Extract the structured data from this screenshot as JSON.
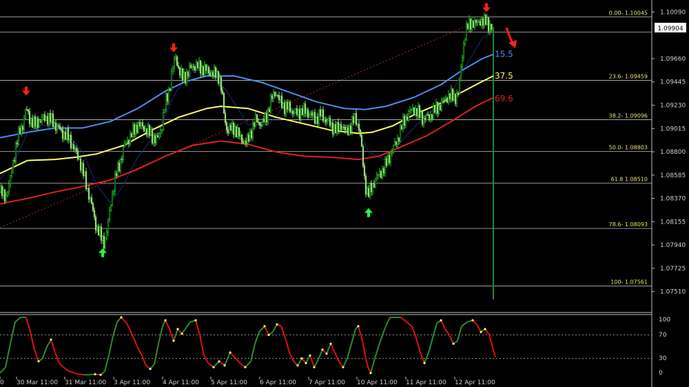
{
  "chart_data": {
    "type": "candlestick",
    "main": {
      "ylim": [
        1.074,
        1.1015
      ],
      "y_ticks": [
        "1.10090",
        "1.09660",
        "1.09445",
        "1.09230",
        "1.09015",
        "1.08800",
        "1.08585",
        "1.08370",
        "1.08155",
        "1.07940",
        "1.07725",
        "1.07510"
      ],
      "current_price": "1.09904",
      "fib_levels": [
        {
          "label": "0.00- 1.10045",
          "value": 1.10045
        },
        {
          "label": "23.6- 1.09459",
          "value": 1.09459
        },
        {
          "label": "38.2- 1.09096",
          "value": 1.09096
        },
        {
          "label": "50.0- 1.08803",
          "value": 1.08803
        },
        {
          "label": "61.8 1.08510",
          "value": 1.0851
        },
        {
          "label": "78.6- 1.08093",
          "value": 1.08093
        },
        {
          "label": "100- 1.07561",
          "value": 1.07561
        }
      ],
      "ma_labels": [
        {
          "text": "15.5",
          "color": "#4b8ff0",
          "value": 1.097
        },
        {
          "text": "37.5",
          "color": "#ffff66",
          "value": 1.095
        },
        {
          "text": "69.6",
          "color": "#e02020",
          "value": 1.0929
        }
      ],
      "close_path": [
        [
          0,
          1.0843
        ],
        [
          8,
          1.0838
        ],
        [
          15,
          1.0854
        ],
        [
          22,
          1.0882
        ],
        [
          28,
          1.0898
        ],
        [
          33,
          1.0905
        ],
        [
          38,
          1.092
        ],
        [
          42,
          1.0912
        ],
        [
          50,
          1.0905
        ],
        [
          60,
          1.091
        ],
        [
          70,
          1.0912
        ],
        [
          80,
          1.0905
        ],
        [
          90,
          1.0898
        ],
        [
          100,
          1.0893
        ],
        [
          108,
          1.0882
        ],
        [
          115,
          1.0873
        ],
        [
          122,
          1.0858
        ],
        [
          130,
          1.0838
        ],
        [
          135,
          1.0825
        ],
        [
          140,
          1.081
        ],
        [
          148,
          1.08
        ],
        [
          152,
          1.0796
        ],
        [
          156,
          1.081
        ],
        [
          162,
          1.0838
        ],
        [
          168,
          1.0858
        ],
        [
          175,
          1.0872
        ],
        [
          182,
          1.0888
        ],
        [
          190,
          1.0895
        ],
        [
          200,
          1.0905
        ],
        [
          210,
          1.0902
        ],
        [
          220,
          1.0895
        ],
        [
          228,
          1.089
        ],
        [
          235,
          1.0905
        ],
        [
          240,
          1.0925
        ],
        [
          245,
          1.0935
        ],
        [
          250,
          1.0955
        ],
        [
          255,
          1.0968
        ],
        [
          260,
          1.0955
        ],
        [
          265,
          1.0948
        ],
        [
          272,
          1.0952
        ],
        [
          280,
          1.096
        ],
        [
          290,
          1.0958
        ],
        [
          300,
          1.0955
        ],
        [
          310,
          1.0952
        ],
        [
          318,
          1.095
        ],
        [
          322,
          1.0935
        ],
        [
          326,
          1.091
        ],
        [
          330,
          1.09
        ],
        [
          340,
          1.0902
        ],
        [
          350,
          1.0892
        ],
        [
          358,
          1.0888
        ],
        [
          365,
          1.09
        ],
        [
          372,
          1.091
        ],
        [
          380,
          1.0905
        ],
        [
          388,
          1.0915
        ],
        [
          395,
          1.093
        ],
        [
          400,
          1.0936
        ],
        [
          405,
          1.0928
        ],
        [
          412,
          1.0922
        ],
        [
          420,
          1.092
        ],
        [
          430,
          1.0915
        ],
        [
          440,
          1.0918
        ],
        [
          450,
          1.0915
        ],
        [
          458,
          1.091
        ],
        [
          465,
          1.0915
        ],
        [
          472,
          1.091
        ],
        [
          480,
          1.0905
        ],
        [
          488,
          1.09
        ],
        [
          495,
          1.0905
        ],
        [
          502,
          1.0898
        ],
        [
          510,
          1.0905
        ],
        [
          516,
          1.0912
        ],
        [
          522,
          1.09
        ],
        [
          526,
          1.0875
        ],
        [
          530,
          1.085
        ],
        [
          534,
          1.084
        ],
        [
          538,
          1.0845
        ],
        [
          545,
          1.0855
        ],
        [
          552,
          1.086
        ],
        [
          560,
          1.0868
        ],
        [
          568,
          1.088
        ],
        [
          576,
          1.089
        ],
        [
          584,
          1.0905
        ],
        [
          592,
          1.0915
        ],
        [
          600,
          1.092
        ],
        [
          608,
          1.0915
        ],
        [
          615,
          1.091
        ],
        [
          622,
          1.0912
        ],
        [
          630,
          1.0918
        ],
        [
          638,
          1.0922
        ],
        [
          645,
          1.0928
        ],
        [
          652,
          1.0932
        ],
        [
          660,
          1.093
        ],
        [
          666,
          1.0935
        ],
        [
          670,
          1.0965
        ],
        [
          674,
          1.0985
        ],
        [
          678,
          1.0995
        ],
        [
          684,
          1.1
        ],
        [
          690,
          1.0997
        ],
        [
          696,
          1.1002
        ],
        [
          702,
          1.0998
        ],
        [
          706,
          1.1003
        ],
        [
          710,
          1.0996
        ],
        [
          716,
          1.099
        ]
      ],
      "ma_blue": [
        [
          0,
          1.0893
        ],
        [
          40,
          1.0898
        ],
        [
          80,
          1.0902
        ],
        [
          120,
          1.0902
        ],
        [
          160,
          1.0908
        ],
        [
          200,
          1.092
        ],
        [
          240,
          1.0936
        ],
        [
          270,
          1.0945
        ],
        [
          300,
          1.095
        ],
        [
          340,
          1.095
        ],
        [
          380,
          1.0944
        ],
        [
          420,
          1.0935
        ],
        [
          460,
          1.0926
        ],
        [
          500,
          1.092
        ],
        [
          530,
          1.0919
        ],
        [
          560,
          1.0922
        ],
        [
          600,
          1.093
        ],
        [
          640,
          1.0942
        ],
        [
          670,
          1.0955
        ],
        [
          700,
          1.0966
        ],
        [
          716,
          1.097
        ]
      ],
      "ma_yellow": [
        [
          0,
          1.086
        ],
        [
          40,
          1.0872
        ],
        [
          80,
          1.0873
        ],
        [
          110,
          1.0875
        ],
        [
          140,
          1.0878
        ],
        [
          180,
          1.0886
        ],
        [
          220,
          1.09
        ],
        [
          260,
          1.0912
        ],
        [
          300,
          1.092
        ],
        [
          320,
          1.0922
        ],
        [
          360,
          1.092
        ],
        [
          400,
          1.0912
        ],
        [
          440,
          1.0906
        ],
        [
          480,
          1.09
        ],
        [
          520,
          1.0897
        ],
        [
          540,
          1.0898
        ],
        [
          570,
          1.0904
        ],
        [
          600,
          1.0914
        ],
        [
          640,
          1.0925
        ],
        [
          670,
          1.0935
        ],
        [
          700,
          1.0945
        ],
        [
          716,
          1.095
        ]
      ],
      "ma_red": [
        [
          0,
          1.0832
        ],
        [
          40,
          1.0837
        ],
        [
          80,
          1.0843
        ],
        [
          120,
          1.0848
        ],
        [
          160,
          1.0854
        ],
        [
          200,
          1.0864
        ],
        [
          240,
          1.0876
        ],
        [
          280,
          1.0886
        ],
        [
          320,
          1.089
        ],
        [
          360,
          1.0887
        ],
        [
          400,
          1.088
        ],
        [
          440,
          1.0876
        ],
        [
          480,
          1.0875
        ],
        [
          520,
          1.0873
        ],
        [
          550,
          1.0876
        ],
        [
          580,
          1.0884
        ],
        [
          620,
          1.0895
        ],
        [
          660,
          1.091
        ],
        [
          690,
          1.0922
        ],
        [
          716,
          1.093
        ]
      ],
      "ma_thin": [
        [
          0,
          1.0855
        ],
        [
          20,
          1.087
        ],
        [
          40,
          1.0898
        ],
        [
          60,
          1.0905
        ],
        [
          80,
          1.0903
        ],
        [
          100,
          1.0895
        ],
        [
          120,
          1.088
        ],
        [
          140,
          1.085
        ],
        [
          160,
          1.0833
        ],
        [
          175,
          1.0845
        ],
        [
          200,
          1.0875
        ],
        [
          230,
          1.09
        ],
        [
          255,
          1.0935
        ],
        [
          280,
          1.0955
        ],
        [
          305,
          1.0957
        ],
        [
          330,
          1.0935
        ],
        [
          360,
          1.0905
        ],
        [
          390,
          1.0905
        ],
        [
          410,
          1.092
        ],
        [
          440,
          1.092
        ],
        [
          470,
          1.0912
        ],
        [
          500,
          1.0905
        ],
        [
          520,
          1.09
        ],
        [
          535,
          1.088
        ],
        [
          560,
          1.0872
        ],
        [
          590,
          1.0895
        ],
        [
          620,
          1.0915
        ],
        [
          650,
          1.0928
        ],
        [
          675,
          1.0958
        ],
        [
          700,
          1.0985
        ],
        [
          716,
          1.099
        ]
      ],
      "sell_arrows": [
        [
          38,
          1.093
        ],
        [
          252,
          1.097
        ],
        [
          706,
          1.1007
        ]
      ],
      "buy_arrows": [
        [
          149,
          1.0793
        ],
        [
          535,
          1.083
        ]
      ]
    },
    "oscillator": {
      "y_ticks": [
        "100",
        "70",
        "30",
        "0"
      ],
      "levels": [
        70,
        30
      ],
      "values": [
        [
          0,
          5
        ],
        [
          8,
          15
        ],
        [
          15,
          55
        ],
        [
          22,
          92
        ],
        [
          30,
          100
        ],
        [
          38,
          100
        ],
        [
          44,
          75
        ],
        [
          50,
          45
        ],
        [
          56,
          25
        ],
        [
          62,
          30
        ],
        [
          68,
          50
        ],
        [
          74,
          62
        ],
        [
          80,
          40
        ],
        [
          86,
          22
        ],
        [
          92,
          15
        ],
        [
          100,
          8
        ],
        [
          108,
          5
        ],
        [
          115,
          3
        ],
        [
          122,
          2
        ],
        [
          130,
          2
        ],
        [
          138,
          3
        ],
        [
          146,
          2
        ],
        [
          152,
          8
        ],
        [
          158,
          35
        ],
        [
          164,
          68
        ],
        [
          170,
          92
        ],
        [
          176,
          100
        ],
        [
          184,
          90
        ],
        [
          192,
          70
        ],
        [
          200,
          48
        ],
        [
          206,
          35
        ],
        [
          212,
          18
        ],
        [
          218,
          12
        ],
        [
          224,
          20
        ],
        [
          230,
          55
        ],
        [
          236,
          85
        ],
        [
          240,
          95
        ],
        [
          246,
          80
        ],
        [
          252,
          60
        ],
        [
          258,
          80
        ],
        [
          264,
          72
        ],
        [
          270,
          82
        ],
        [
          276,
          92
        ],
        [
          284,
          95
        ],
        [
          290,
          70
        ],
        [
          296,
          35
        ],
        [
          302,
          22
        ],
        [
          310,
          15
        ],
        [
          318,
          25
        ],
        [
          326,
          18
        ],
        [
          334,
          40
        ],
        [
          342,
          30
        ],
        [
          350,
          20
        ],
        [
          356,
          15
        ],
        [
          364,
          25
        ],
        [
          370,
          55
        ],
        [
          376,
          75
        ],
        [
          384,
          85
        ],
        [
          390,
          70
        ],
        [
          396,
          75
        ],
        [
          402,
          88
        ],
        [
          408,
          85
        ],
        [
          414,
          65
        ],
        [
          420,
          40
        ],
        [
          426,
          25
        ],
        [
          432,
          18
        ],
        [
          438,
          30
        ],
        [
          444,
          22
        ],
        [
          450,
          35
        ],
        [
          456,
          15
        ],
        [
          462,
          28
        ],
        [
          468,
          45
        ],
        [
          474,
          38
        ],
        [
          480,
          55
        ],
        [
          486,
          40
        ],
        [
          492,
          25
        ],
        [
          498,
          15
        ],
        [
          504,
          30
        ],
        [
          510,
          55
        ],
        [
          516,
          80
        ],
        [
          520,
          85
        ],
        [
          526,
          60
        ],
        [
          530,
          35
        ],
        [
          534,
          15
        ],
        [
          538,
          5
        ],
        [
          544,
          30
        ],
        [
          552,
          60
        ],
        [
          560,
          85
        ],
        [
          566,
          100
        ],
        [
          574,
          100
        ],
        [
          582,
          100
        ],
        [
          590,
          92
        ],
        [
          598,
          85
        ],
        [
          604,
          65
        ],
        [
          610,
          40
        ],
        [
          616,
          22
        ],
        [
          622,
          40
        ],
        [
          628,
          65
        ],
        [
          634,
          90
        ],
        [
          640,
          95
        ],
        [
          646,
          80
        ],
        [
          652,
          70
        ],
        [
          658,
          55
        ],
        [
          664,
          60
        ],
        [
          670,
          85
        ],
        [
          678,
          92
        ],
        [
          686,
          95
        ],
        [
          692,
          88
        ],
        [
          698,
          75
        ],
        [
          704,
          80
        ],
        [
          710,
          70
        ],
        [
          716,
          45
        ],
        [
          719,
          32
        ]
      ]
    },
    "x_labels": [
      "0",
      "30 Mar 11:00",
      "31 Mar 11:00",
      "3 Apr 11:00",
      "4 Apr 11:00",
      "5 Apr 11:00",
      "6 Apr 11:00",
      "7 Apr 11:00",
      "10 Apr 11:00",
      "11 Apr 11:00",
      "12 Apr 11:00"
    ]
  },
  "colors": {
    "bull": "#22cc22",
    "bear": "#9bdc7a",
    "grid_line": "#c0c0c0",
    "fib_label": "#e8e860",
    "green_vline": "#1f8f1f",
    "osc_up": "#2e8b2e",
    "osc_down": "#e01010",
    "osc_turn": "#ffff66"
  }
}
